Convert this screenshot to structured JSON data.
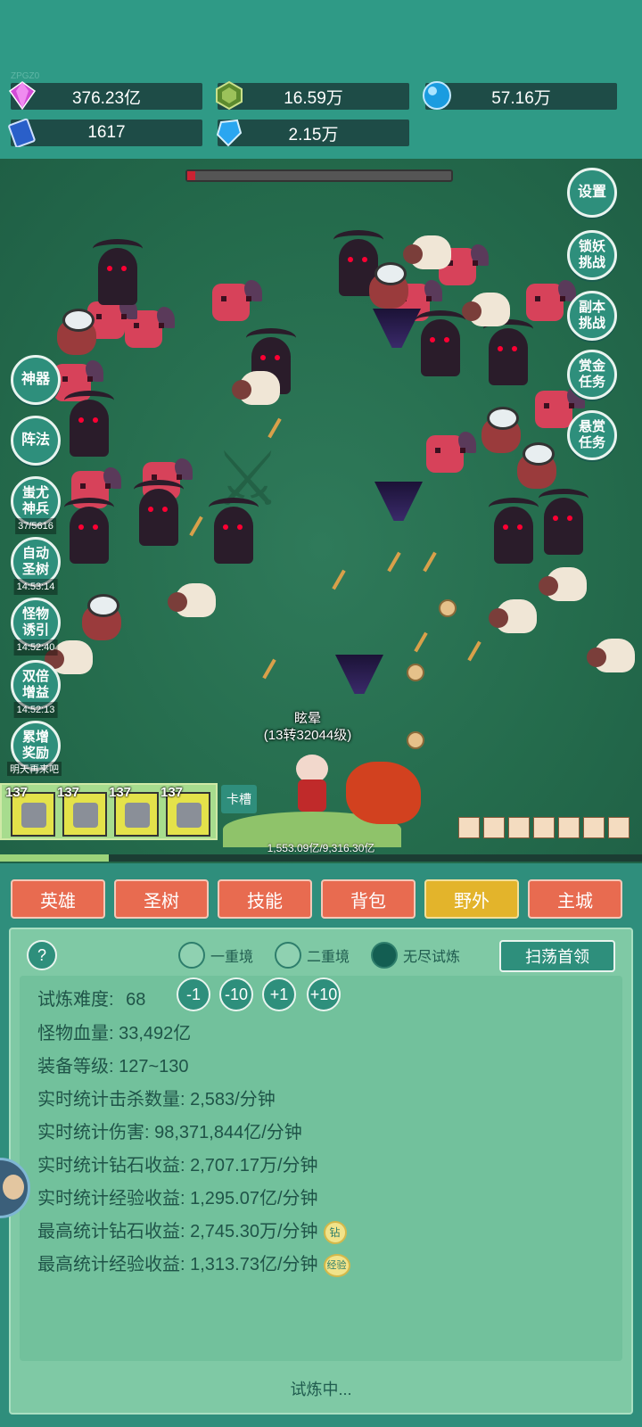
{
  "watermark_tag": "ZPGZ0",
  "resources": {
    "diamond": "376.23亿",
    "green_gem": "16.59万",
    "blue_orb": "57.16万",
    "book": "1617",
    "crystal": "2.15万"
  },
  "right_buttons": {
    "settings": "设置",
    "lock_demon": "锁妖\n挑战",
    "dungeon": "副本\n挑战",
    "bounty_gold": "赏金\n任务",
    "bounty_reward": "悬赏\n任务"
  },
  "left_buttons": {
    "artifact": "神器",
    "formation": "阵法",
    "chiyou": "蚩尤\n神兵",
    "chiyou_sub": "37/5616",
    "auto_tree": "自动\n圣树",
    "auto_tree_sub": "14:53:14",
    "lure": "怪物\n诱引",
    "lure_sub": "14:52:40",
    "double": "双倍\n增益",
    "double_sub": "14:52:13",
    "accum": "累增\n奖励",
    "tomorrow": "明天再来吧"
  },
  "hero": {
    "name": "眩晕",
    "level": "(13转32044级)"
  },
  "equipment_levels": [
    "137",
    "137",
    "137",
    "137"
  ],
  "card_slot": "卡槽",
  "exp_text": "1,553.09亿/9,316.30亿",
  "exp_progress": 0.17,
  "boss_hp": 0.03,
  "tabs": [
    "英雄",
    "圣树",
    "技能",
    "背包",
    "野外",
    "主城"
  ],
  "active_tab": "野外",
  "panel": {
    "help": "?",
    "modes": [
      "一重境",
      "二重境",
      "无尽试炼"
    ],
    "selected_mode": "无尽试炼",
    "sweep_button": "扫荡首领",
    "difficulty_label": "试炼难度:",
    "difficulty_value": "68",
    "adjust": [
      "-1",
      "-10",
      "+1",
      "+10"
    ],
    "stats": [
      "怪物血量: 33,492亿",
      "装备等级: 127~130",
      "实时统计击杀数量: 2,583/分钟",
      "实时统计伤害: 98,371,844亿/分钟",
      "实时统计钻石收益: 2,707.17万/分钟",
      "实时统计经验收益: 1,295.07亿/分钟",
      "最高统计钻石收益: 2,745.30万/分钟",
      "最高统计经验收益: 1,313.73亿/分钟"
    ],
    "badge_diamond": "钻",
    "badge_exp": "经验",
    "status": "试炼中..."
  },
  "colors": {
    "accent": "#2e8f7c",
    "tab_inactive": "#e86b50",
    "tab_active": "#e3b42b",
    "panel_bg": "#7fc9a5"
  }
}
